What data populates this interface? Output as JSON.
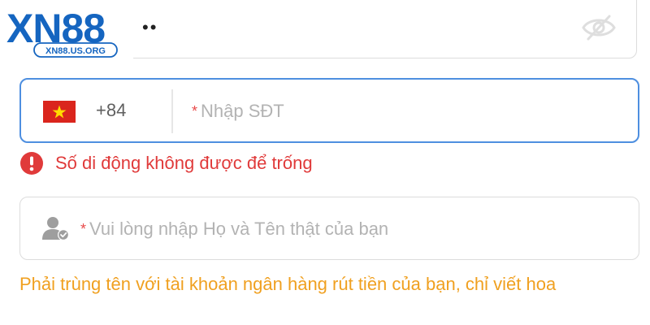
{
  "logo": {
    "brand": "XN88",
    "url_text": "XN88.US.ORG",
    "colors": {
      "primary": "#1565c0",
      "outline": "#ffffff",
      "background": "#ffffff"
    }
  },
  "password_field": {
    "masked_value": "••",
    "toggle_icon": "eye-slash-icon"
  },
  "phone_field": {
    "flag_icon": "vietnam-flag-icon",
    "country_code": "+84",
    "required_mark": "*",
    "placeholder": "Nhập SĐT",
    "value": "",
    "border_color": "#4e8fe0"
  },
  "phone_error": {
    "icon": "exclamation-circle-icon",
    "message": "Số di động không được để trống",
    "color": "#e03a3a"
  },
  "name_field": {
    "icon": "user-check-icon",
    "required_mark": "*",
    "placeholder": "Vui lòng nhập Họ và Tên thật của bạn",
    "value": ""
  },
  "name_hint": {
    "message": "Phải trùng tên với tài khoản ngân hàng rút tiền của bạn, chỉ viết hoa",
    "color": "#f0a020"
  }
}
